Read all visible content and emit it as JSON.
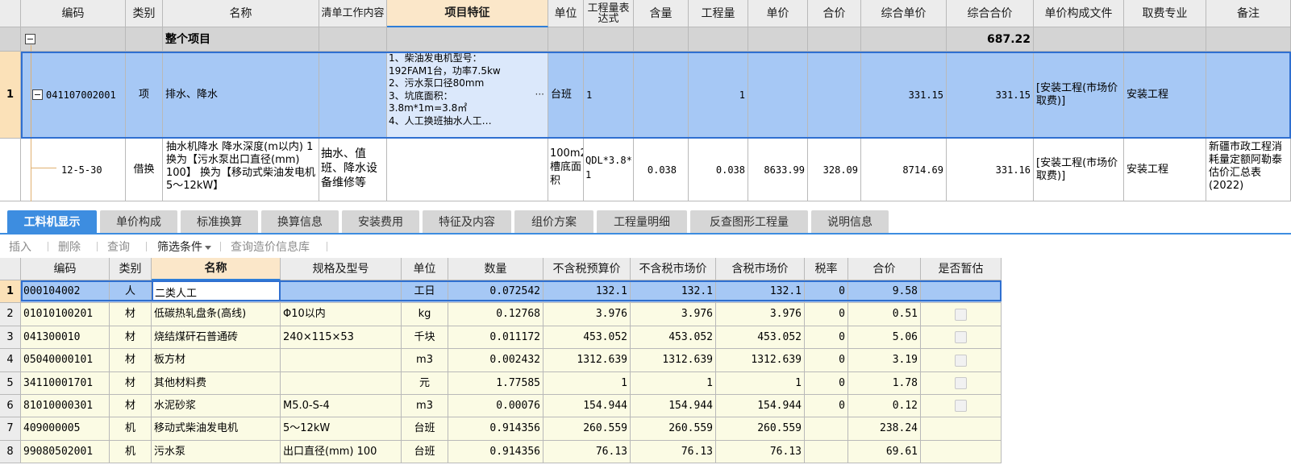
{
  "top_table": {
    "headers": {
      "code": "编码",
      "type": "类别",
      "name": "名称",
      "work": "清单工作内容",
      "feature": "项目特征",
      "unit": "单位",
      "expr": "工程量表达式",
      "content": "含量",
      "qty": "工程量",
      "price": "单价",
      "total": "合价",
      "cprice": "综合单价",
      "ctotal": "综合合价",
      "file": "单价构成文件",
      "fee": "取费专业",
      "remark": "备注"
    },
    "summary": {
      "label": "整个项目",
      "ctotal": "687.22"
    },
    "item": {
      "row_no": "1",
      "code": "041107002001",
      "type": "项",
      "name": "排水、降水",
      "feature": "1、柴油发电机型号：\n192FAM1台，功率7.5kw\n2、污水泵口径80mm\n3、坑底面积：\n3.8m*1m=3.8㎡\n4、人工换班抽水人工…",
      "ellipsis": "···",
      "unit": "台班",
      "expr": "1",
      "qty": "1",
      "cprice": "331.15",
      "ctotal": "331.15",
      "file": "[安装工程(市场价取费)]",
      "fee": "安装工程"
    },
    "sub": {
      "code": "12-5-30",
      "type": "借换",
      "name": "抽水机降水 降水深度(m以内) 1  换为【污水泵出口直径(mm) 100】  换为【移动式柴油发电机5～12kW】",
      "work": "抽水、值班、降水设备维修等",
      "unit": "100m2槽底面积",
      "expr": "QDL*3.8*1",
      "content": "0.038",
      "qty": "0.038",
      "price": "8633.99",
      "total": "328.09",
      "cprice": "8714.69",
      "ctotal": "331.16",
      "file": "[安装工程(市场价取费)]",
      "fee": "安装工程",
      "remark": "新疆市政工程消耗量定额阿勒泰估价汇总表(2022)"
    }
  },
  "tabs": [
    "工料机显示",
    "单价构成",
    "标准换算",
    "换算信息",
    "安装费用",
    "特征及内容",
    "组价方案",
    "工程量明细",
    "反查图形工程量",
    "说明信息"
  ],
  "toolbar": {
    "insert": "插入",
    "delete": "删除",
    "query": "查询",
    "filter": "筛选条件",
    "query_price": "查询造价信息库"
  },
  "bottom_table": {
    "headers": {
      "code": "编码",
      "type": "类别",
      "name": "名称",
      "spec": "规格及型号",
      "unit": "单位",
      "qty": "数量",
      "budget": "不含税预算价",
      "market": "不含税市场价",
      "taxmarket": "含税市场价",
      "rate": "税率",
      "total": "合价",
      "temp": "是否暂估"
    },
    "rows": [
      {
        "no": "1",
        "code": "000104002",
        "type": "人",
        "name": "二类人工",
        "spec": "",
        "unit": "工日",
        "qty": "0.072542",
        "budget": "132.1",
        "market": "132.1",
        "taxmarket": "132.1",
        "rate": "0",
        "total": "9.58",
        "chk": false
      },
      {
        "no": "2",
        "code": "01010100201",
        "type": "材",
        "name": "低碳热轧盘条(高线)",
        "spec": "Φ10以内",
        "unit": "kg",
        "qty": "0.12768",
        "budget": "3.976",
        "market": "3.976",
        "taxmarket": "3.976",
        "rate": "0",
        "total": "0.51",
        "chk": true
      },
      {
        "no": "3",
        "code": "041300010",
        "type": "材",
        "name": "烧结煤矸石普通砖",
        "spec": "240×115×53",
        "unit": "千块",
        "qty": "0.011172",
        "budget": "453.052",
        "market": "453.052",
        "taxmarket": "453.052",
        "rate": "0",
        "total": "5.06",
        "chk": true
      },
      {
        "no": "4",
        "code": "05040000101",
        "type": "材",
        "name": "板方材",
        "spec": "",
        "unit": "m3",
        "qty": "0.002432",
        "budget": "1312.639",
        "market": "1312.639",
        "taxmarket": "1312.639",
        "rate": "0",
        "total": "3.19",
        "chk": true
      },
      {
        "no": "5",
        "code": "34110001701",
        "type": "材",
        "name": "其他材料费",
        "spec": "",
        "unit": "元",
        "qty": "1.77585",
        "budget": "1",
        "market": "1",
        "taxmarket": "1",
        "rate": "0",
        "total": "1.78",
        "chk": true
      },
      {
        "no": "6",
        "code": "81010000301",
        "type": "材",
        "name": "水泥砂浆",
        "spec": "M5.0-S-4",
        "unit": "m3",
        "qty": "0.00076",
        "budget": "154.944",
        "market": "154.944",
        "taxmarket": "154.944",
        "rate": "0",
        "total": "0.12",
        "chk": true
      },
      {
        "no": "7",
        "code": "409000005",
        "type": "机",
        "name": "移动式柴油发电机",
        "spec": "5～12kW",
        "unit": "台班",
        "qty": "0.914356",
        "budget": "260.559",
        "market": "260.559",
        "taxmarket": "260.559",
        "rate": "",
        "total": "238.24",
        "chk": false
      },
      {
        "no": "8",
        "code": "99080502001",
        "type": "机",
        "name": "污水泵",
        "spec": "出口直径(mm) 100",
        "unit": "台班",
        "qty": "0.914356",
        "budget": "76.13",
        "market": "76.13",
        "taxmarket": "76.13",
        "rate": "",
        "total": "69.61",
        "chk": false
      }
    ]
  },
  "colors": {
    "accent": "#3d8de0",
    "selection": "#a6c8f5",
    "row_bg": "#fbfbe4",
    "header_bg": "#ececec",
    "highlight_header": "#fbe7c9"
  }
}
